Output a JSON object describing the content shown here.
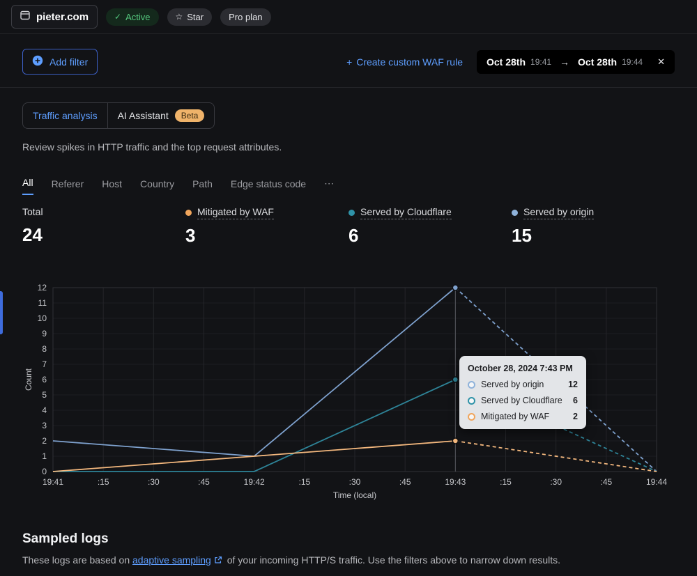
{
  "colors": {
    "accent": "#5e9eff",
    "green": "#55c87e",
    "waf": "#f0a55c",
    "cloudflare": "#2f93a8",
    "origin": "#8fb2da"
  },
  "icons": {
    "check": "✓",
    "star": "☆",
    "arrow_right": "→",
    "close": "✕",
    "plus": "+",
    "ellipsis": "⋯"
  },
  "topbar": {
    "domain": "pieter.com",
    "active_badge": "Active",
    "star_badge": "Star",
    "plan_badge": "Pro plan"
  },
  "filter_bar": {
    "add_filter": "Add filter",
    "create_waf_rule": "Create custom WAF rule",
    "date_range": {
      "start_date": "Oct 28th",
      "start_time": "19:41",
      "end_date": "Oct 28th",
      "end_time": "19:44"
    }
  },
  "tabs": {
    "traffic_analysis": "Traffic analysis",
    "ai_assistant": "AI Assistant",
    "beta": "Beta"
  },
  "description": "Review spikes in HTTP traffic and the top request attributes.",
  "attribute_tabs": {
    "items": [
      "All",
      "Referer",
      "Host",
      "Country",
      "Path",
      "Edge status code"
    ]
  },
  "stats": {
    "total_label": "Total",
    "total_value": "24",
    "items": [
      {
        "label": "Mitigated by WAF",
        "value": "3"
      },
      {
        "label": "Served by Cloudflare",
        "value": "6"
      },
      {
        "label": "Served by origin",
        "value": "15"
      }
    ]
  },
  "chart_data": {
    "type": "line",
    "title": "",
    "xlabel": "Time (local)",
    "ylabel": "Count",
    "ylim": [
      0,
      12
    ],
    "y_ticks": [
      0,
      1,
      2,
      3,
      4,
      5,
      6,
      7,
      8,
      9,
      10,
      11,
      12
    ],
    "x_ticks": [
      "19:41",
      ":15",
      ":30",
      ":45",
      "19:42",
      ":15",
      ":30",
      ":45",
      "19:43",
      ":15",
      ":30",
      ":45",
      "19:44"
    ],
    "crosshair_tick": 8,
    "grid": true,
    "legend_position": "none",
    "series": [
      {
        "name": "Served by origin",
        "color": "#7fa2cf",
        "points": [
          {
            "x": 0,
            "y": 2
          },
          {
            "x": 4,
            "y": 1
          },
          {
            "x": 8,
            "y": 12
          },
          {
            "x": 12,
            "y": 0
          }
        ],
        "solid_until_x": 8
      },
      {
        "name": "Served by Cloudflare",
        "color": "#2e8498",
        "points": [
          {
            "x": 0,
            "y": 0
          },
          {
            "x": 4,
            "y": 0
          },
          {
            "x": 8,
            "y": 6
          },
          {
            "x": 12,
            "y": 0
          }
        ],
        "solid_until_x": 8
      },
      {
        "name": "Mitigated by WAF",
        "color": "#f4b87e",
        "points": [
          {
            "x": 0,
            "y": 0
          },
          {
            "x": 4,
            "y": 1
          },
          {
            "x": 8,
            "y": 2
          },
          {
            "x": 12,
            "y": 0
          }
        ],
        "solid_until_x": 8
      }
    ]
  },
  "tooltip": {
    "title": "October 28, 2024 7:43 PM",
    "rows": [
      {
        "label": "Served by origin",
        "value": "12"
      },
      {
        "label": "Served by Cloudflare",
        "value": "6"
      },
      {
        "label": "Mitigated by WAF",
        "value": "2"
      }
    ]
  },
  "sampled_logs": {
    "title": "Sampled logs",
    "text_before": "These logs are based on",
    "link": "adaptive sampling",
    "text_after": "of your incoming HTTP/S traffic. Use the filters above to narrow down results."
  }
}
